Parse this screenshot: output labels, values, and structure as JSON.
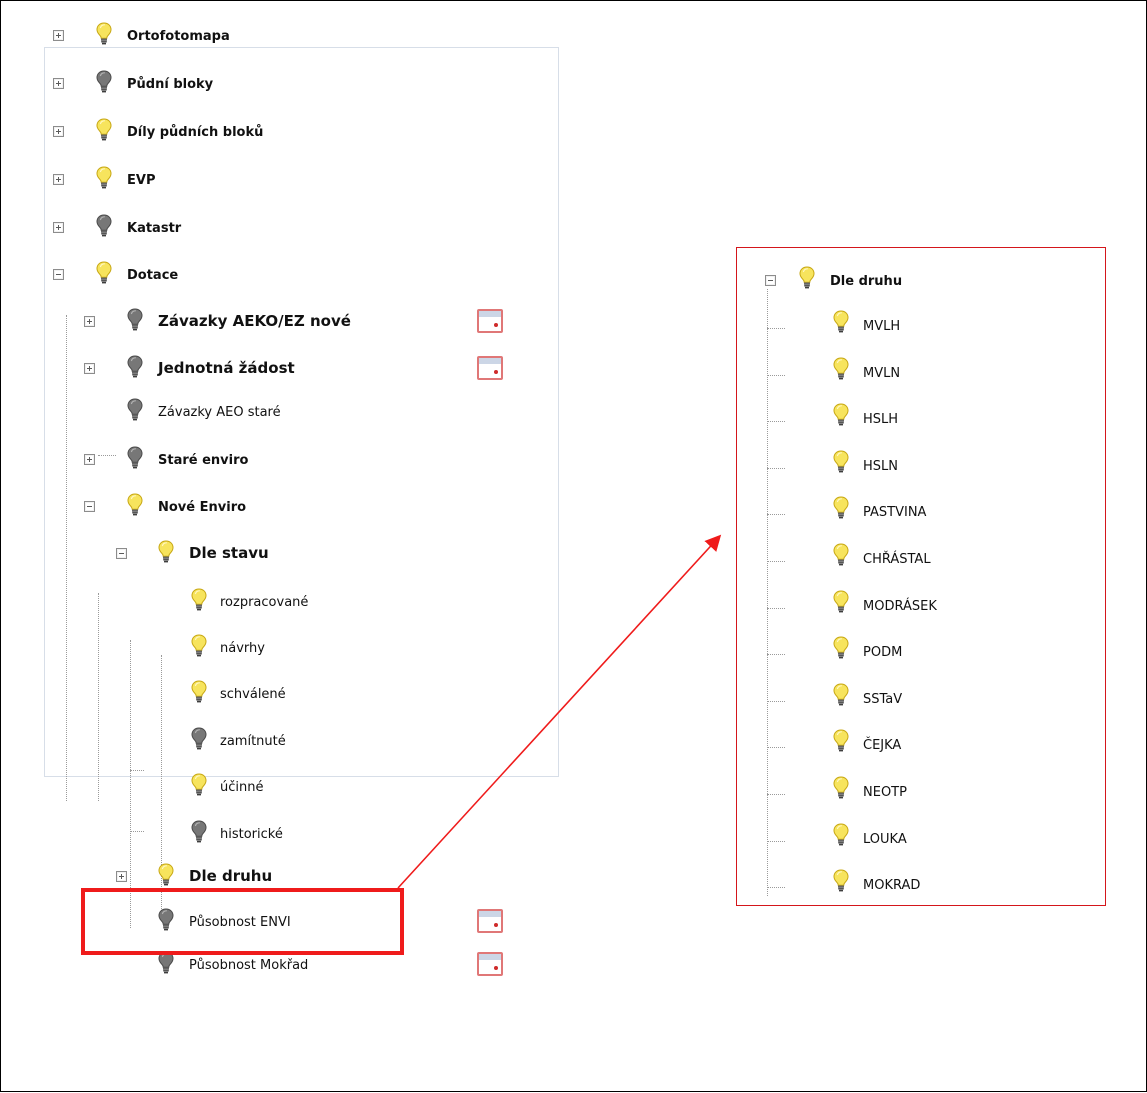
{
  "colors": {
    "bulb_on": "#f7e45d",
    "bulb_off": "#777777",
    "highlight_red": "#ef1b1b"
  },
  "icons": {
    "layer_on": "lightbulb-on-icon",
    "layer_off": "lightbulb-off-icon",
    "expand": "plus-box-icon",
    "collapse": "minus-box-icon",
    "calendar": "calendar-icon"
  },
  "left_tree": [
    {
      "id": "ortofotomapa",
      "label": "Ortofotomapa",
      "bold": true,
      "toggle": "plus",
      "bulb": "on"
    },
    {
      "id": "pudni-bloky",
      "label": "Půdní bloky",
      "bold": true,
      "toggle": "plus",
      "bulb": "off"
    },
    {
      "id": "dily-pudnich-bloku",
      "label": "Díly půdních bloků",
      "bold": true,
      "toggle": "plus",
      "bulb": "on"
    },
    {
      "id": "evp",
      "label": "EVP",
      "bold": true,
      "toggle": "plus",
      "bulb": "on"
    },
    {
      "id": "katastr",
      "label": "Katastr",
      "bold": true,
      "toggle": "plus",
      "bulb": "off"
    },
    {
      "id": "dotace",
      "label": "Dotace",
      "bold": true,
      "toggle": "minus",
      "bulb": "on"
    },
    {
      "id": "zavazky-aeko-ez-nove",
      "label": "Závazky AEKO/EZ nové",
      "bold": true,
      "big": true,
      "toggle": "plus",
      "bulb": "off",
      "calendar": true
    },
    {
      "id": "jednotna-zadost",
      "label": "Jednotná žádost",
      "bold": true,
      "big": true,
      "toggle": "plus",
      "bulb": "off",
      "calendar": true
    },
    {
      "id": "zavazky-aeo-stare",
      "label": "Závazky AEO staré",
      "bold": false,
      "toggle": "none",
      "bulb": "off"
    },
    {
      "id": "stare-enviro",
      "label": "Staré enviro",
      "bold": true,
      "toggle": "plus",
      "bulb": "off"
    },
    {
      "id": "nove-enviro",
      "label": "Nové Enviro",
      "bold": true,
      "toggle": "minus",
      "bulb": "on"
    },
    {
      "id": "dle-stavu",
      "label": "Dle stavu",
      "bold": true,
      "big": true,
      "toggle": "minus",
      "bulb": "on"
    },
    {
      "id": "rozpracovane",
      "label": "rozpracované",
      "bold": false,
      "toggle": "none",
      "bulb": "on"
    },
    {
      "id": "navrhy",
      "label": "návrhy",
      "bold": false,
      "toggle": "none",
      "bulb": "on"
    },
    {
      "id": "schvalene",
      "label": "schválené",
      "bold": false,
      "toggle": "none",
      "bulb": "on"
    },
    {
      "id": "zamitnute",
      "label": "zamítnuté",
      "bold": false,
      "toggle": "none",
      "bulb": "off"
    },
    {
      "id": "ucinne",
      "label": "účinné",
      "bold": false,
      "toggle": "none",
      "bulb": "on"
    },
    {
      "id": "historicke",
      "label": "historické",
      "bold": false,
      "toggle": "none",
      "bulb": "off"
    },
    {
      "id": "dle-druhu",
      "label": "Dle druhu",
      "bold": true,
      "big": true,
      "toggle": "plus",
      "bulb": "on"
    },
    {
      "id": "pusobnost-envi",
      "label": "Působnost ENVI",
      "bold": false,
      "toggle": "none",
      "bulb": "off",
      "calendar": true
    },
    {
      "id": "pusobnost-mokrad",
      "label": "Působnost Mokřad",
      "bold": false,
      "toggle": "none",
      "bulb": "off",
      "calendar": true
    }
  ],
  "right_tree": {
    "root": {
      "label": "Dle druhu",
      "toggle": "minus",
      "bulb": "on"
    },
    "items": [
      {
        "label": "MVLH",
        "bulb": "on"
      },
      {
        "label": "MVLN",
        "bulb": "on"
      },
      {
        "label": "HSLH",
        "bulb": "on"
      },
      {
        "label": "HSLN",
        "bulb": "on"
      },
      {
        "label": "PASTVINA",
        "bulb": "on"
      },
      {
        "label": "CHŘÁSTAL",
        "bulb": "on"
      },
      {
        "label": "MODRÁSEK",
        "bulb": "on"
      },
      {
        "label": "PODM",
        "bulb": "on"
      },
      {
        "label": "SSTaV",
        "bulb": "on"
      },
      {
        "label": "ČEJKA",
        "bulb": "on"
      },
      {
        "label": "NEOTP",
        "bulb": "on"
      },
      {
        "label": "LOUKA",
        "bulb": "on"
      },
      {
        "label": "MOKRAD",
        "bulb": "on"
      }
    ]
  }
}
